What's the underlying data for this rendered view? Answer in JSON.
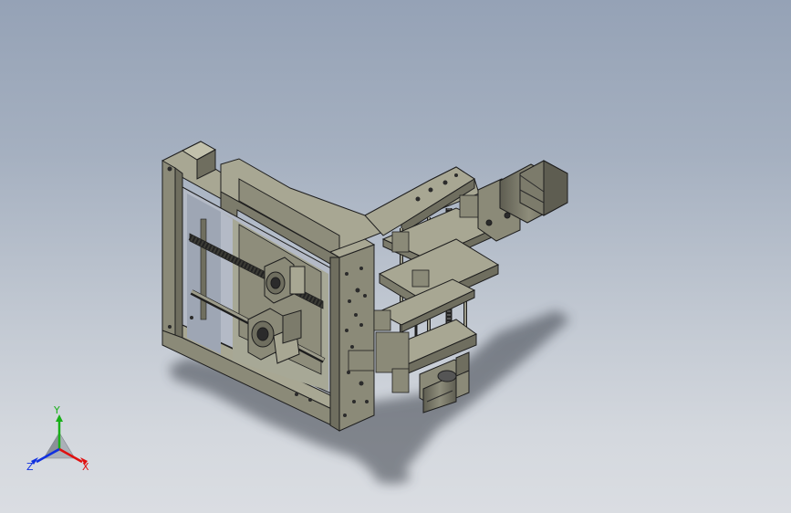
{
  "viewport": {
    "background_top": "#95a2b6",
    "background_bottom": "#dadde2",
    "part_color": "#8b8a78",
    "part_shade": "#6f6e5f",
    "part_light": "#a8a793",
    "edge_color": "#1e1e1e",
    "shadow_color": "#3a3f48"
  },
  "triad": {
    "x_label": "X",
    "y_label": "Y",
    "z_label": "Z",
    "x_color": "#e01010",
    "y_color": "#18b018",
    "z_color": "#1030e0"
  }
}
